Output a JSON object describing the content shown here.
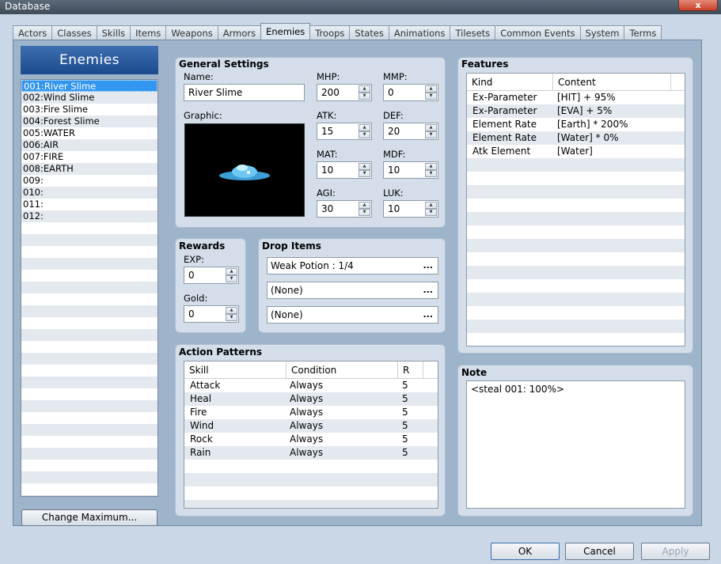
{
  "window": {
    "title": "Database",
    "close_glyph": "x"
  },
  "tabs": [
    "Actors",
    "Classes",
    "Skills",
    "Items",
    "Weapons",
    "Armors",
    "Enemies",
    "Troops",
    "States",
    "Animations",
    "Tilesets",
    "Common Events",
    "System",
    "Terms"
  ],
  "active_tab": "Enemies",
  "left": {
    "header": "Enemies",
    "items": [
      "001:River Slime",
      "002:Wind Slime",
      "003:Fire Slime",
      "004:Forest Slime",
      "005:WATER",
      "006:AIR",
      "007:FIRE",
      "008:EARTH",
      "009:",
      "010:",
      "011:",
      "012:"
    ],
    "change_max_label": "Change Maximum..."
  },
  "general": {
    "title": "General Settings",
    "name_label": "Name:",
    "name_value": "River Slime",
    "graphic_label": "Graphic:",
    "graphic_icon": "slime-sprite",
    "params": {
      "mhp_label": "MHP:",
      "mhp": "200",
      "mmp_label": "MMP:",
      "mmp": "0",
      "atk_label": "ATK:",
      "atk": "15",
      "def_label": "DEF:",
      "def": "20",
      "mat_label": "MAT:",
      "mat": "10",
      "mdf_label": "MDF:",
      "mdf": "10",
      "agi_label": "AGI:",
      "agi": "30",
      "luk_label": "LUK:",
      "luk": "10"
    }
  },
  "rewards": {
    "title": "Rewards",
    "exp_label": "EXP:",
    "exp": "0",
    "gold_label": "Gold:",
    "gold": "0"
  },
  "drops": {
    "title": "Drop Items",
    "items": [
      "Weak Potion : 1/4",
      "(None)",
      "(None)"
    ],
    "dots": "..."
  },
  "actions": {
    "title": "Action Patterns",
    "headers": [
      "Skill",
      "Condition",
      "R"
    ],
    "rows": [
      [
        "Attack",
        "Always",
        "5"
      ],
      [
        "Heal",
        "Always",
        "5"
      ],
      [
        "Fire",
        "Always",
        "5"
      ],
      [
        "Wind",
        "Always",
        "5"
      ],
      [
        "Rock",
        "Always",
        "5"
      ],
      [
        "Rain",
        "Always",
        "5"
      ]
    ]
  },
  "features": {
    "title": "Features",
    "headers": [
      "Kind",
      "Content"
    ],
    "rows": [
      [
        "Ex-Parameter",
        "[HIT] + 95%"
      ],
      [
        "Ex-Parameter",
        "[EVA] + 5%"
      ],
      [
        "Element Rate",
        "[Earth] * 200%"
      ],
      [
        "Element Rate",
        "[Water] * 0%"
      ],
      [
        "Atk Element",
        "[Water]"
      ]
    ]
  },
  "note": {
    "title": "Note",
    "text": "<steal 001: 100%>"
  },
  "buttons": {
    "ok": "OK",
    "cancel": "Cancel",
    "apply": "Apply"
  }
}
